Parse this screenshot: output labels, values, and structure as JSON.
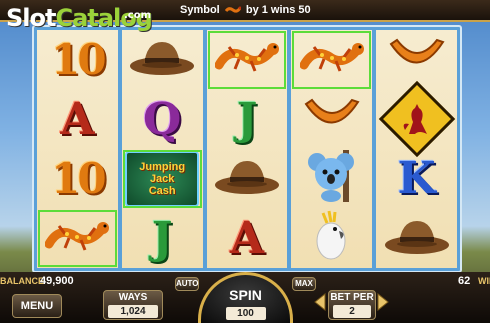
{
  "watermark": {
    "slot": "Slot",
    "catalog": "Catalog",
    "com": ".com"
  },
  "top": {
    "message_prefix": "Symbol",
    "message_suffix": "by 1 wins 50"
  },
  "reels": [
    [
      {
        "sym": "10",
        "win": false
      },
      {
        "sym": "A",
        "win": false
      },
      {
        "sym": "10",
        "win": false
      },
      {
        "sym": "lizard",
        "win": true
      }
    ],
    [
      {
        "sym": "hat",
        "win": false
      },
      {
        "sym": "Q",
        "win": false
      },
      {
        "sym": "bonus",
        "win": true
      },
      {
        "sym": "J",
        "win": false
      }
    ],
    [
      {
        "sym": "lizard",
        "win": true
      },
      {
        "sym": "J",
        "win": false
      },
      {
        "sym": "hat",
        "win": false
      },
      {
        "sym": "A",
        "win": false
      }
    ],
    [
      {
        "sym": "lizard",
        "win": true
      },
      {
        "sym": "boomerang",
        "win": false
      },
      {
        "sym": "koala",
        "win": false
      },
      {
        "sym": "cockatoo",
        "win": false
      }
    ],
    [
      {
        "sym": "boomerang",
        "win": false
      },
      {
        "sym": "kangaroo-sign",
        "win": false
      },
      {
        "sym": "K",
        "win": false
      },
      {
        "sym": "hat",
        "win": false
      }
    ]
  ],
  "bonus_text": [
    "Jumping",
    "Jack",
    "Cash"
  ],
  "bottom": {
    "balance_label": "BALANCE",
    "balance_value": "49,900",
    "win_value": "62",
    "win_label": "WIN",
    "menu": "MENU",
    "ways_label": "WAYS",
    "ways_value": "1,024",
    "auto": "AUTO",
    "max": "MAX",
    "spin_label": "SPIN",
    "spin_value": "100",
    "bet_per_label": "BET PER",
    "bet_per_value": "2"
  },
  "colors": {
    "win_frame": "#5cdc3a",
    "reel_bg": "#f6ecd0",
    "accent_gold": "#d9b04a"
  }
}
